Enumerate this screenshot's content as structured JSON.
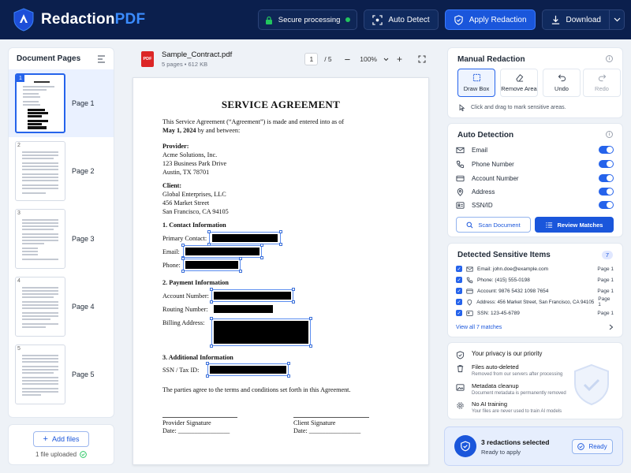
{
  "app": {
    "name_part1": "Redaction",
    "name_part2": "PDF"
  },
  "header": {
    "secure_label": "Secure processing",
    "auto_detect_label": "Auto Detect",
    "apply_label": "Apply Redaction",
    "download_label": "Download"
  },
  "sidebar": {
    "title": "Document Pages",
    "pages": [
      {
        "num": "1",
        "label": "Page 1"
      },
      {
        "num": "2",
        "label": "Page 2"
      },
      {
        "num": "3",
        "label": "Page 3"
      },
      {
        "num": "4",
        "label": "Page 4"
      },
      {
        "num": "5",
        "label": "Page 5"
      }
    ],
    "add_files_label": "Add files",
    "uploaded_text": "1 file uploaded"
  },
  "doc": {
    "filename": "Sample_Contract.pdf",
    "meta": "5 pages  •  612 KB",
    "pdf_badge": "PDF",
    "current_page": "1",
    "total_pages": "/ 5",
    "zoom": "100%",
    "title": "SERVICE AGREEMENT",
    "intro1": "This Service Agreement (“Agreement”) is made and entered into as of",
    "intro2_date": "May 1, 2024",
    "intro2_rest": " by and between:",
    "provider_h": "Provider:",
    "provider_lines": [
      "Acme Solutions, Inc.",
      "123 Business Park Drive",
      "Austin, TX 78701"
    ],
    "client_h": "Client:",
    "client_lines": [
      "Global Enterprises, LLC",
      "456 Market Street",
      "San Francisco, CA 94105"
    ],
    "s1": "1.   Contact Information",
    "primary_contact": "Primary Contact:",
    "email": "Email:",
    "phone": "Phone:",
    "s2": "2.   Payment Information",
    "account_number": "Account Number:",
    "routing_number": "Routing Number:",
    "billing_address": "Billing Address:",
    "s3": "3.   Additional Information",
    "ssn": "SSN / Tax ID:",
    "closing": "The parties agree to the terms and conditions set forth in this Agreement.",
    "provider_sig": "Provider Signature",
    "client_sig": "Client Signature",
    "date1": "Date: ________________",
    "date2": "Date: ________________"
  },
  "manual": {
    "title": "Manual Redaction",
    "tools": [
      "Draw Box",
      "Remove Area",
      "Undo",
      "Redo"
    ],
    "hint": "Click and drag to mark sensitive areas."
  },
  "auto": {
    "title": "Auto Detection",
    "items": [
      "Email",
      "Phone Number",
      "Account Number",
      "Address",
      "SSN/ID"
    ],
    "scan_label": "Scan Document",
    "review_label": "Review Matches"
  },
  "detected": {
    "title": "Detected Sensitive Items",
    "count": "7",
    "items": [
      {
        "label": "Email:",
        "value": "john.doe@example.com",
        "page": "Page 1"
      },
      {
        "label": "Phone:",
        "value": "(415) 555-0198",
        "page": "Page 1"
      },
      {
        "label": "Account:",
        "value": "9876 5432 1098 7654",
        "page": "Page 1"
      },
      {
        "label": "Address:",
        "value": "456 Market Street, San Francisco, CA 94105",
        "page": "Page 1"
      },
      {
        "label": "SSN:",
        "value": "123-45-6789",
        "page": "Page 1"
      }
    ],
    "view_all": "View all 7 matches"
  },
  "privacy": {
    "title": "Your privacy is our priority",
    "items": [
      {
        "t1": "Files auto-deleted",
        "t2": "Removed from our servers after processing"
      },
      {
        "t1": "Metadata cleanup",
        "t2": "Document metadata is permanently removed"
      },
      {
        "t1": "No AI training",
        "t2": "Your files are never used to train AI models"
      }
    ]
  },
  "status": {
    "selected": "3 redactions selected",
    "sub": "Ready to apply",
    "ready": "Ready"
  },
  "colors": {
    "header_bg": "#0b1f4d",
    "accent": "#1a56db",
    "success": "#22c55e",
    "redaction": "#000000"
  }
}
